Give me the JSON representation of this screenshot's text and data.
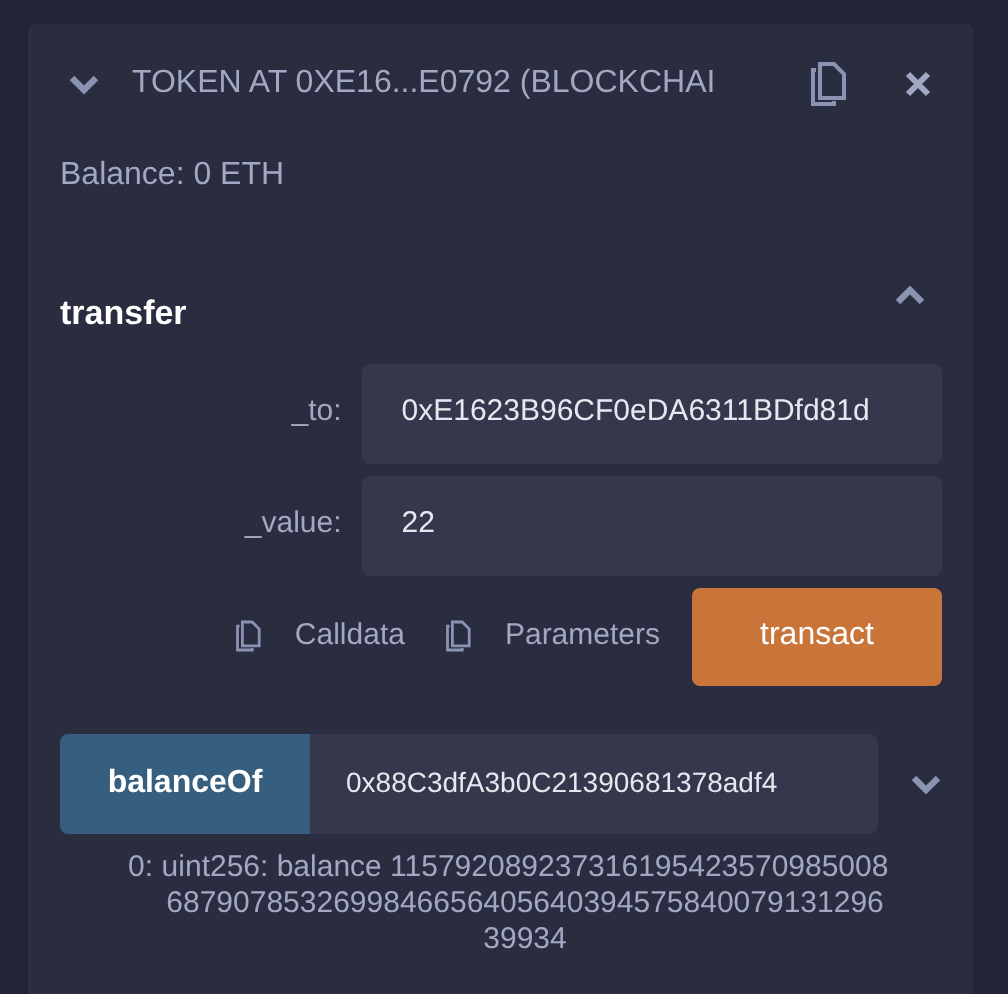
{
  "panel": {
    "title": "TOKEN AT 0XE16...E0792 (BLOCKCHAI",
    "expanded": true,
    "balance": "Balance: 0 ETH"
  },
  "transfer": {
    "name": "transfer",
    "expanded": true,
    "params": [
      {
        "label": "_to:",
        "value": "0xE1623B96CF0eDA6311BDfd81d"
      },
      {
        "label": "_value:",
        "value": "22"
      }
    ],
    "calldata": "Calldata",
    "parameters": "Parameters",
    "button": "transact"
  },
  "balance_of": {
    "name": "balanceOf",
    "value": "0x88C3dfA3b0C21390681378adf4",
    "expanded": false,
    "result_index": "0:",
    "result": "uint256: balance 115792089237316195423570985008687907853269984665640564039457584007913129639934"
  }
}
